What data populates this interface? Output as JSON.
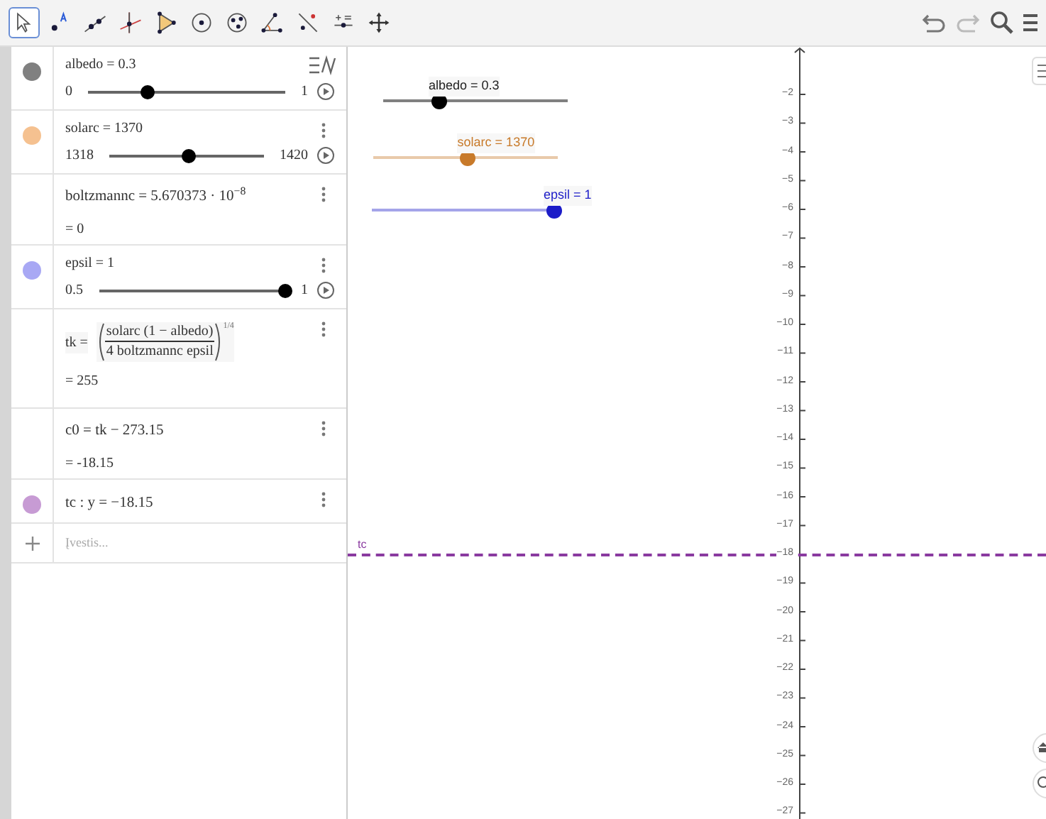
{
  "toolbar": {
    "tools": [
      {
        "selected": true
      },
      {
        "selected": false
      },
      {
        "selected": false
      },
      {
        "selected": false
      },
      {
        "selected": false
      },
      {
        "selected": false
      },
      {
        "selected": false
      },
      {
        "selected": false
      },
      {
        "selected": false
      },
      {
        "selected": false
      },
      {
        "selected": false
      }
    ]
  },
  "algebra": {
    "items": [
      {
        "kind": "slider",
        "color": "#808080",
        "expression": "albedo = 0.3",
        "min": "0",
        "max": "1",
        "level": 0.3
      },
      {
        "kind": "slider",
        "color": "#f5c190",
        "expression": "solarc = 1370",
        "min": "1318",
        "max": "1420",
        "level": 0.51
      },
      {
        "kind": "number",
        "expression": "boltzmannc = 5.670373 · 10$^{−8}$",
        "result": "= 0"
      },
      {
        "kind": "slider",
        "color": "#a8a8f4",
        "expression": "epsil = 1",
        "min": "0.5",
        "max": "1",
        "level": 1
      },
      {
        "kind": "formula",
        "lhs": "tk =",
        "numerator": "solarc (1 − albedo)",
        "denominator": "4 boltzmannc epsil",
        "exponent": "1/4",
        "result": "= 255"
      },
      {
        "kind": "expression",
        "expression": "c0 = tk − 273.15",
        "result": "= -18.15"
      },
      {
        "kind": "line",
        "color": "#c79bd4",
        "expression": "tc : y = −18.15"
      }
    ],
    "input": {
      "placeholder": "Įvestis..."
    }
  },
  "graphics": {
    "sliders": [
      {
        "label": "albedo = 0.3",
        "color": "#000000",
        "level": 0.3
      },
      {
        "label": "solarc = 1370",
        "color": "#c87a2a",
        "level": 0.51
      },
      {
        "label": "epsil = 1",
        "color": "#1c1cc8",
        "level": 1
      }
    ],
    "line_label": "tc",
    "y_axis_ticks": [
      "−2",
      "−3",
      "−4",
      "−5",
      "−6",
      "−7",
      "−8",
      "−9",
      "−10",
      "−11",
      "−12",
      "−13",
      "−14",
      "−15",
      "−16",
      "−17",
      "−18",
      "−19",
      "−20",
      "−21",
      "−22",
      "−23",
      "−24",
      "−25",
      "−26",
      "−27"
    ]
  }
}
